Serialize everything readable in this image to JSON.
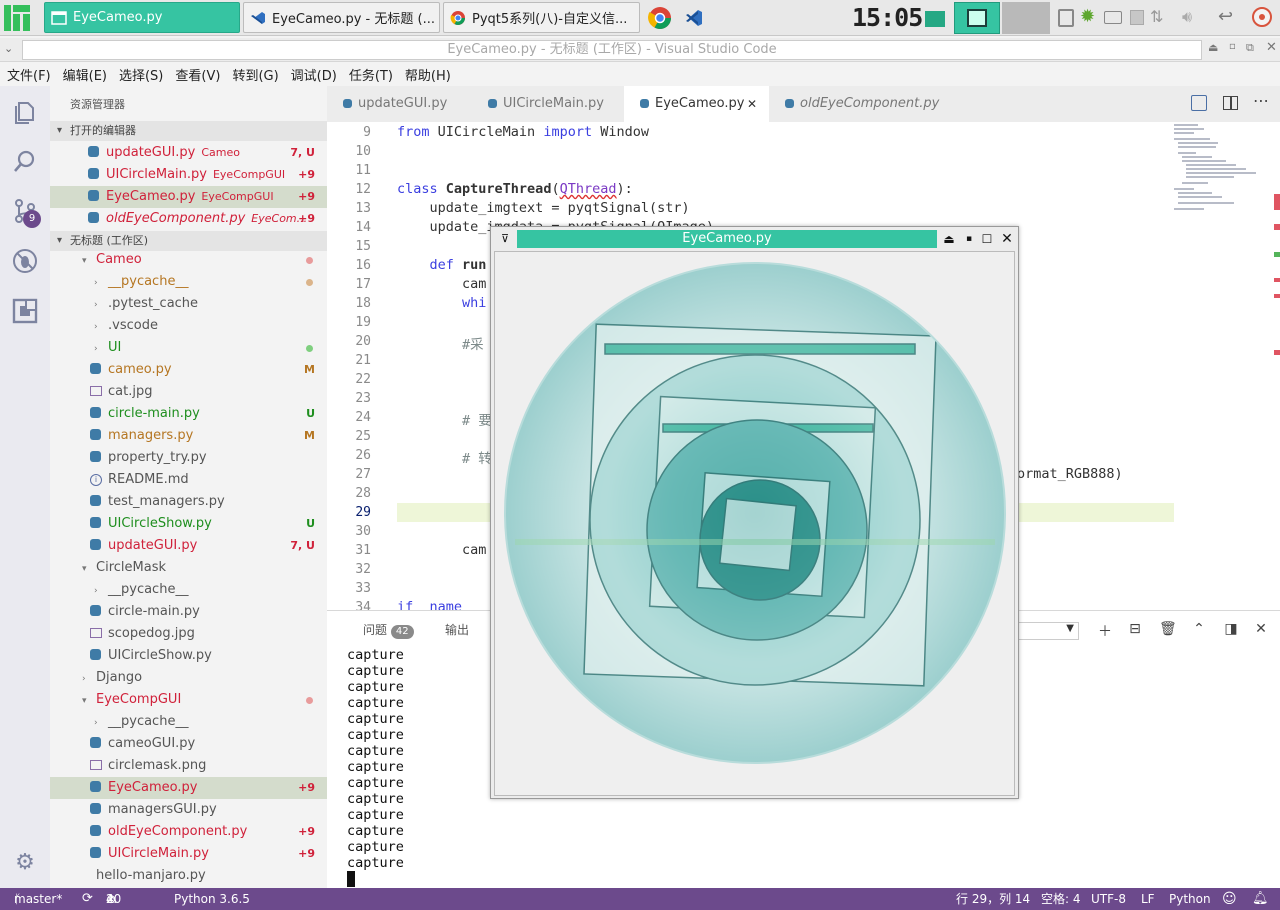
{
  "taskbar": {
    "tasks": [
      {
        "label": "EyeCameo.py"
      },
      {
        "label": "EyeCameo.py - 无标题 (..."
      },
      {
        "label": "Pyqt5系列(八)-自定义信..."
      }
    ],
    "clock": "15:05"
  },
  "window": {
    "title": "EyeCameo.py - 无标题 (工作区) - Visual Studio Code"
  },
  "menu": [
    "文件(F)",
    "编辑(E)",
    "选择(S)",
    "查看(V)",
    "转到(G)",
    "调试(D)",
    "任务(T)",
    "帮助(H)"
  ],
  "activity": {
    "scm_badge": "9"
  },
  "sidebar": {
    "title": "资源管理器",
    "open_editors_label": "打开的编辑器",
    "open_editors": [
      {
        "name": "updateGUI.py",
        "desc": "Cameo",
        "badge": "7, U"
      },
      {
        "name": "UICircleMain.py",
        "desc": "EyeCompGUI",
        "badge": "+9"
      },
      {
        "name": "EyeCameo.py",
        "desc": "EyeCompGUI",
        "badge": "+9"
      },
      {
        "name": "oldEyeComponent.py",
        "desc": "EyeCom...",
        "badge": "+9"
      }
    ],
    "workspace_label": "无标题 (工作区)",
    "tree": [
      {
        "name": "Cameo"
      },
      {
        "name": "__pycache__"
      },
      {
        "name": ".pytest_cache"
      },
      {
        "name": ".vscode"
      },
      {
        "name": "UI"
      },
      {
        "name": "cameo.py",
        "badge": "M"
      },
      {
        "name": "cat.jpg"
      },
      {
        "name": "circle-main.py",
        "badge": "U"
      },
      {
        "name": "managers.py",
        "badge": "M"
      },
      {
        "name": "property_try.py"
      },
      {
        "name": "README.md"
      },
      {
        "name": "test_managers.py"
      },
      {
        "name": "UICircleShow.py",
        "badge": "U"
      },
      {
        "name": "updateGUI.py",
        "badge": "7, U"
      },
      {
        "name": "CircleMask"
      },
      {
        "name": "__pycache__"
      },
      {
        "name": "circle-main.py"
      },
      {
        "name": "scopedog.jpg"
      },
      {
        "name": "UICircleShow.py"
      },
      {
        "name": "Django"
      },
      {
        "name": "EyeCompGUI"
      },
      {
        "name": "__pycache__"
      },
      {
        "name": "cameoGUI.py"
      },
      {
        "name": "circlemask.png"
      },
      {
        "name": "EyeCameo.py",
        "badge": "+9"
      },
      {
        "name": "managersGUI.py"
      },
      {
        "name": "oldEyeComponent.py",
        "badge": "+9"
      },
      {
        "name": "UICircleMain.py",
        "badge": "+9"
      },
      {
        "name": "hello-manjaro.py"
      }
    ]
  },
  "tabs": [
    {
      "label": "updateGUI.py"
    },
    {
      "label": "UICircleMain.py"
    },
    {
      "label": "EyeCameo.py"
    },
    {
      "label": "oldEyeComponent.py"
    }
  ],
  "editor": {
    "line_numbers": [
      "9",
      "10",
      "11",
      "12",
      "13",
      "14",
      "15",
      "16",
      "17",
      "18",
      "19",
      "20",
      "21",
      "22",
      "23",
      "24",
      "25",
      "26",
      "27",
      "28",
      "29",
      "30",
      "31",
      "32",
      "33",
      "34"
    ],
    "lines": {
      "l9": [
        "from",
        " UICircleMain ",
        "import",
        " Window"
      ],
      "l12": [
        "class",
        "CaptureThread",
        "QThread",
        "):"
      ],
      "l13": "    update_imgtext = pyqtSignal(str)",
      "l14": "    update_imgdata = pyqtSignal(QImage)",
      "l16": [
        "    def",
        " run"
      ],
      "l17": "        cam",
      "l18": "        whi",
      "l20": "        #采",
      "l24": "        # 要",
      "l26": "        # 转",
      "l27": "ormat_RGB888)",
      "l31": "        cam",
      "l34": "if  name"
    }
  },
  "panel": {
    "problems_label": "问题",
    "problems_count": "42",
    "output_label": "输出",
    "terminal_lines": [
      "capture",
      "capture",
      "capture",
      "capture",
      "capture",
      "capture",
      "capture",
      "capture",
      "capture",
      "capture",
      "capture",
      "capture",
      "capture",
      "capture"
    ]
  },
  "floating_window": {
    "title": "EyeCameo.py"
  },
  "status": {
    "branch": "master*",
    "errors": "40",
    "warnings": "2",
    "python": "Python 3.6.5",
    "position": "行 29，列 14",
    "spaces": "空格: 4",
    "encoding": "UTF-8",
    "eol": "LF",
    "language": "Python"
  },
  "colors": {
    "accent": "#36c4a2",
    "status_bar": "#6c4a8c",
    "modified_red": "#d0213a"
  }
}
